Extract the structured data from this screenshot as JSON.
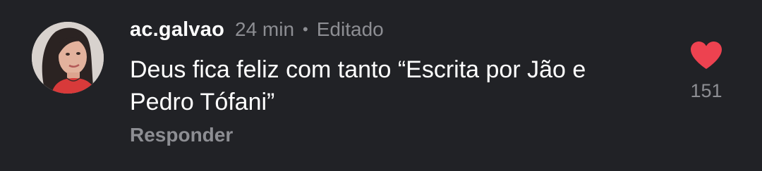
{
  "comment": {
    "username": "ac.galvao",
    "time_ago": "24 min",
    "separator": "•",
    "edited_label": "Editado",
    "text": "Deus fica feliz com tanto “Escrita por Jão e Pedro Tófani”",
    "reply_label": "Responder",
    "likes": "151",
    "liked": true
  },
  "colors": {
    "background": "#212226",
    "text_primary": "#ffffff",
    "text_secondary": "#8d8e93",
    "like_active": "#ed4250"
  },
  "icons": {
    "like": "heart-icon"
  }
}
